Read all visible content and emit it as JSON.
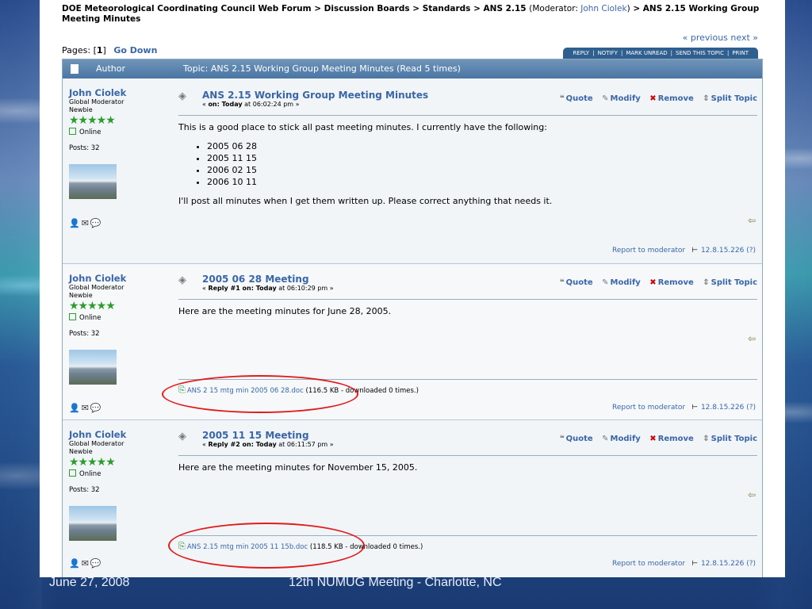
{
  "breadcrumb": {
    "forum": "DOE Meteorological Coordinating Council Web Forum",
    "boards": "Discussion Boards",
    "standards": "Standards",
    "ans": "ANS 2.15",
    "moderator_label": "(Moderator: ",
    "moderator_name": "John Ciolek",
    "moderator_close": ")",
    "topic": "ANS 2.15 Working Group Meeting Minutes",
    "sep": " > "
  },
  "pages": {
    "label": "Pages: [",
    "current": "1",
    "close": "]",
    "go_down": "Go Down"
  },
  "prevnext": "« previous next »",
  "actions": [
    "REPLY",
    "NOTIFY",
    "MARK UNREAD",
    "SEND THIS TOPIC",
    "PRINT"
  ],
  "header": {
    "author": "Author",
    "topic": "Topic: ANS 2.15 Working Group Meeting Minutes  (Read 5 times)"
  },
  "tools": {
    "quote": "Quote",
    "modify": "Modify",
    "remove": "Remove",
    "split": "Split Topic"
  },
  "report_label": "Report to moderator",
  "posts": [
    {
      "author": "John Ciolek",
      "role": "Global Moderator",
      "rank": "Newbie",
      "stars": "★★★★★",
      "status": "Online",
      "posts_count": "Posts: 32",
      "title": "ANS 2.15 Working Group Meeting Minutes",
      "meta_prefix": "« ",
      "meta_bold": "on: Today",
      "meta_rest": " at 06:02:24 pm »",
      "body_intro": "This is a good place to stick all past meeting minutes.  I currently have the following:",
      "list": [
        "2005 06 28",
        "2005 11 15",
        "2006 02 15",
        "2006 10 11"
      ],
      "body_outro": "I'll post all minutes when I get them written up.  Please correct anything that needs it.",
      "ip": "12.8.15.226 (?)"
    },
    {
      "author": "John Ciolek",
      "role": "Global Moderator",
      "rank": "Newbie",
      "stars": "★★★★★",
      "status": "Online",
      "posts_count": "Posts: 32",
      "title": "2005 06 28 Meeting",
      "meta_prefix": "« ",
      "meta_bold": "Reply #1 on: Today",
      "meta_rest": " at 06:10:29 pm »",
      "body": "Here are the meeting minutes for June 28, 2005.",
      "attachment_name": "ANS 2 15 mtg min 2005 06 28.doc",
      "attachment_info": " (116.5 KB - downloaded 0 times.)",
      "ip": "12.8.15.226 (?)"
    },
    {
      "author": "John Ciolek",
      "role": "Global Moderator",
      "rank": "Newbie",
      "stars": "★★★★★",
      "status": "Online",
      "posts_count": "Posts: 32",
      "title": "2005 11 15 Meeting",
      "meta_prefix": "« ",
      "meta_bold": "Reply #2 on: Today",
      "meta_rest": " at 06:11:57 pm »",
      "body": "Here are the meeting minutes for November 15, 2005.",
      "attachment_name": "ANS 2.15 mtg min 2005 11 15b.doc",
      "attachment_info": " (118.5 KB - downloaded 0 times.)",
      "ip": "12.8.15.226 (?)"
    }
  ],
  "footer": {
    "date": "June 27, 2008",
    "event": "12th NUMUG Meeting - Charlotte, NC"
  },
  "colors": {
    "link": "#3a66a6",
    "header": "#4a76a4",
    "annotation": "#e21b1b",
    "stars": "#2c9c2c"
  }
}
